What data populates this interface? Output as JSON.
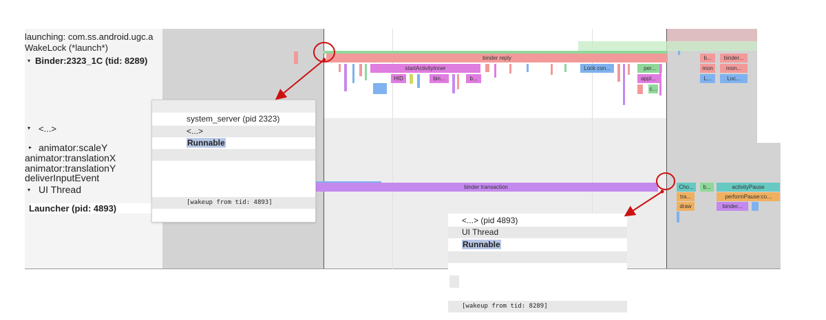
{
  "tracks": {
    "launching": "launching: com.ss.android.ugc.a",
    "wakelock": "WakeLock (*launch*)",
    "binder_thread": "Binder:2323_1C (tid: 8289)",
    "group_collapsed": "<...>",
    "animator_scaley": "animator:scaleY",
    "animator_translationx": "animator:translationX",
    "animator_translationy": "animator:translationY",
    "deliver_input": "deliverInputEvent",
    "ui_thread": "UI Thread",
    "launcher": "Launcher (pid: 4893)"
  },
  "slices": {
    "binder_reply": "binder reply",
    "start_activity_inner": "startActivityInner",
    "hid": "HID",
    "bin": "bin...",
    "b": "b...",
    "lock_con": "Lock con...",
    "per": "per...",
    "appl": "appl...",
    "c": "c...",
    "right_b1": "b...",
    "binder_r": "binder...",
    "mon1": "mon",
    "mon2": "mon...",
    "L1": "L...",
    "Loc": "Loc...",
    "binder_transaction": "binder transaction",
    "cho": "Cho...",
    "b2": "b...",
    "activity_pause": "activityPause",
    "tra": "tra...",
    "perform_pause": "performPause:co...",
    "draw": "draw",
    "binder_r2": "binder..."
  },
  "popup1": {
    "process": "system_server (pid 2323)",
    "thread": "<...>",
    "state": "Runnable",
    "wakeup": "[wakeup from tid: 4893]"
  },
  "popup2": {
    "process": "<...> (pid 4893)",
    "thread": "UI Thread",
    "state": "Runnable",
    "wakeup": "[wakeup from tid: 8289]"
  },
  "colors": {
    "annotation": "#cc1111",
    "binder": "#f29a9a",
    "magenta": "#e07de0",
    "purple": "#c489ee",
    "blue": "#7fb2ee",
    "green": "#8fd89a",
    "teal": "#66c9c2",
    "runnable_highlight": "#b8c7e6"
  }
}
